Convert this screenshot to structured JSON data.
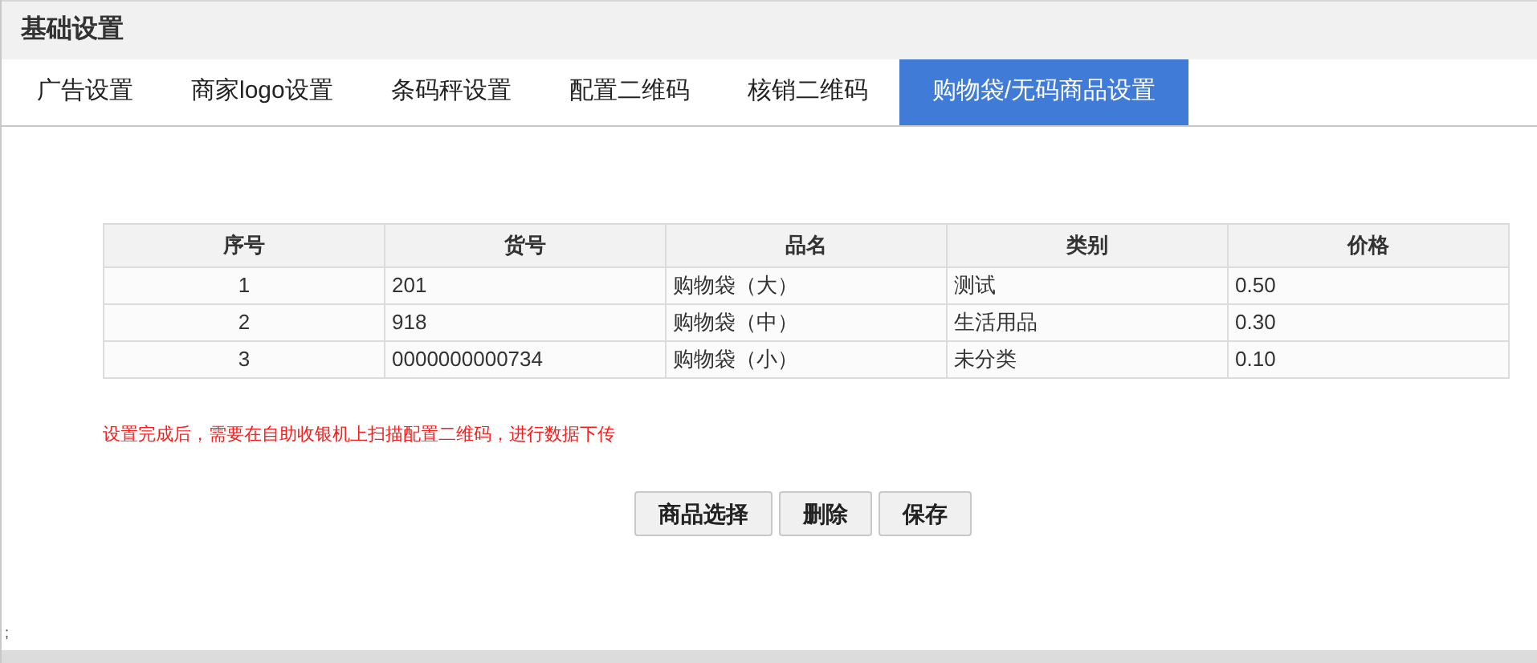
{
  "page_title": "基础设置",
  "tabs": [
    {
      "label": "广告设置",
      "selected": false
    },
    {
      "label": "商家logo设置",
      "selected": false
    },
    {
      "label": "条码秤设置",
      "selected": false
    },
    {
      "label": "配置二维码",
      "selected": false
    },
    {
      "label": "核销二维码",
      "selected": false
    },
    {
      "label": "购物袋/无码商品设置",
      "selected": true
    }
  ],
  "table": {
    "columns": [
      "序号",
      "货号",
      "品名",
      "类别",
      "价格"
    ],
    "rows": [
      [
        "1",
        "201",
        "购物袋（大）",
        "测试",
        "0.50"
      ],
      [
        "2",
        "918",
        "购物袋（中）",
        "生活用品",
        "0.30"
      ],
      [
        "3",
        "0000000000734",
        "购物袋（小）",
        "未分类",
        "0.10"
      ]
    ]
  },
  "note": "设置完成后，需要在自助收银机上扫描配置二维码，进行数据下传",
  "buttons": [
    "商品选择",
    "删除",
    "保存"
  ],
  "footer_mark": ";"
}
